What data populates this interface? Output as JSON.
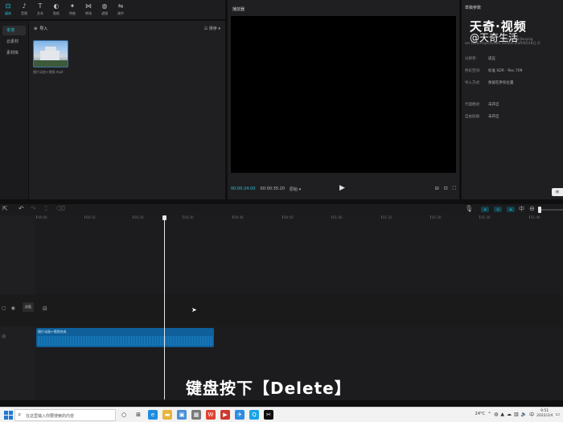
{
  "toolbar": {
    "items": [
      {
        "label": "媒体",
        "icon": "import-media-icon",
        "glyph": "⊡"
      },
      {
        "label": "音频",
        "icon": "audio-icon",
        "glyph": "♪"
      },
      {
        "label": "文本",
        "icon": "text-icon",
        "glyph": "T"
      },
      {
        "label": "贴纸",
        "icon": "sticker-icon",
        "glyph": "◐"
      },
      {
        "label": "特效",
        "icon": "effects-icon",
        "glyph": "✦"
      },
      {
        "label": "转场",
        "icon": "transition-icon",
        "glyph": "⋈"
      },
      {
        "label": "滤镜",
        "icon": "filter-icon",
        "glyph": "◍"
      },
      {
        "label": "调节",
        "icon": "adjust-icon",
        "glyph": "⇋"
      }
    ]
  },
  "media_nav": {
    "items": [
      "本地",
      "云素材",
      "素材库"
    ]
  },
  "media": {
    "import_label": "导入",
    "sort_label": "排序",
    "clip_name": "图片动态+视频.mp4"
  },
  "player": {
    "title": "播放器",
    "current_time": "00:00:24:00",
    "total_time": "00:00:35:20",
    "ratio": "原始"
  },
  "params": {
    "title": "草稿参数",
    "path": "ver Data/Projects/com.lveditor.draft/9月16日 (2",
    "path_prefix": "Data/Local/Jianying",
    "rows": [
      {
        "k": "分辨率:",
        "v": "适应"
      },
      {
        "k": "色彩空间:",
        "v": "标准 SDR - Rec.709"
      },
      {
        "k": "导入方式:",
        "v": "保留在原有位置"
      },
      {
        "k": "代理模式:",
        "v": "未开启"
      },
      {
        "k": "自由层级:",
        "v": "未开启"
      }
    ],
    "export_label": "修"
  },
  "watermark": {
    "text": "天奇·视频",
    "mark": "@天奇生活"
  },
  "timeline": {
    "ruler": [
      "00:00",
      "00:10",
      "00:20",
      "00:30",
      "00:40",
      "00:50",
      "01:00",
      "01:10",
      "01:20",
      "01:30",
      "01:40"
    ],
    "cover_label": "封面",
    "clip_label": "图片动画+视频合成",
    "blue_buttons": [
      "⊞",
      "⊟",
      "⊠",
      "⊡"
    ],
    "playhead_seconds": 23.5
  },
  "subtitle": "键盘按下【Delete】",
  "taskbar": {
    "search_placeholder": "在这里输入你要搜索的内容",
    "temperature": "24°C",
    "time": "9:51",
    "date": "2022/2/4",
    "input_method": "中"
  },
  "colors": {
    "accent": "#29c4d8",
    "clip": "#0e5f9a"
  }
}
